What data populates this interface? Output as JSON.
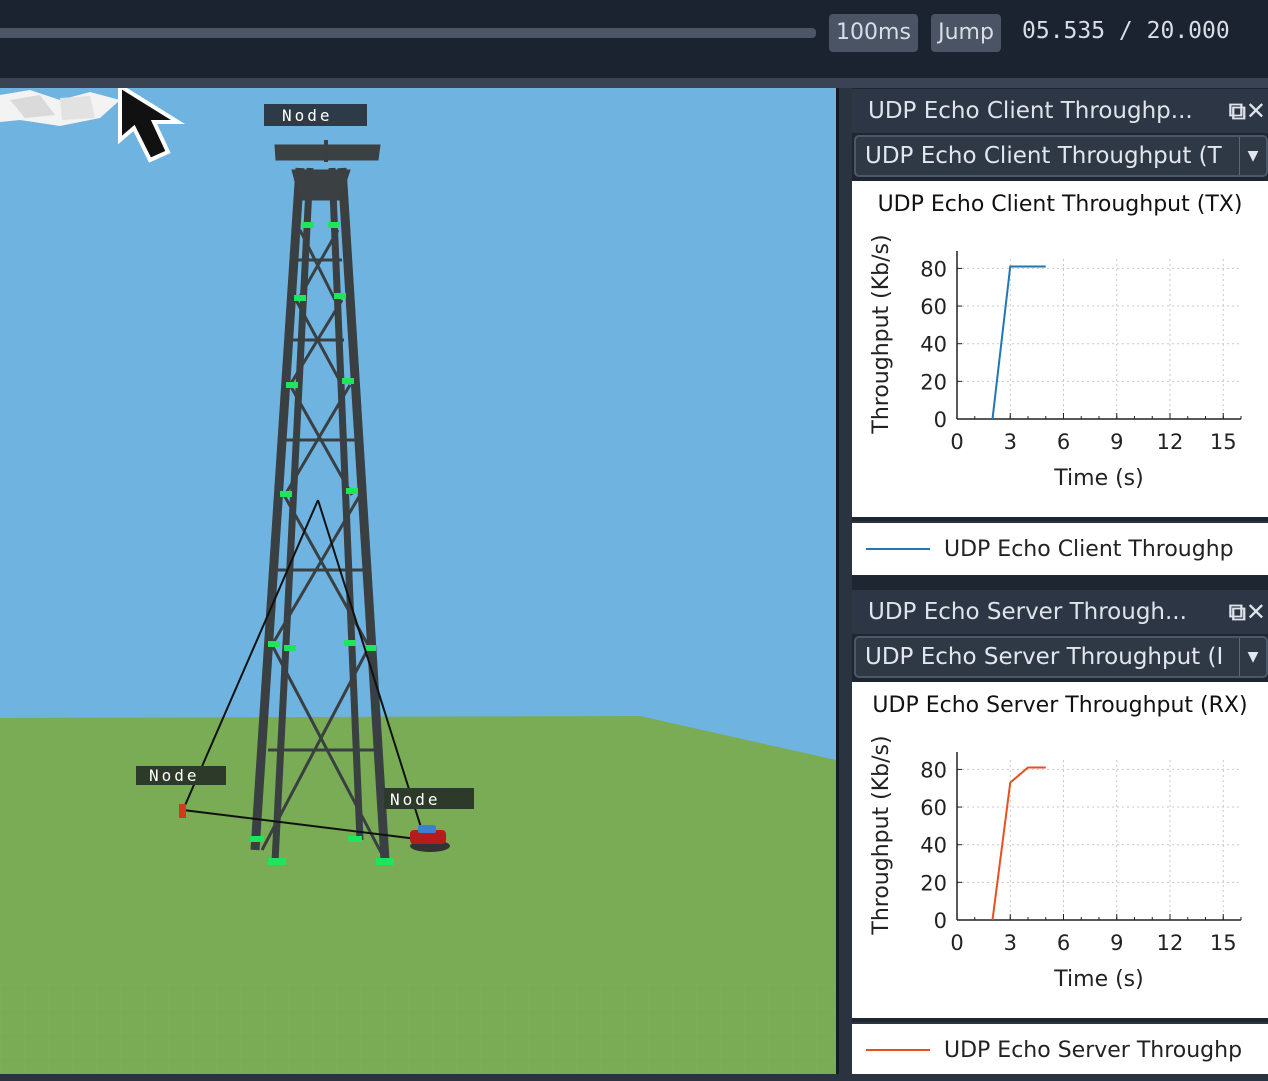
{
  "toolbar": {
    "step_label": "100ms",
    "jump_label": "Jump",
    "time_readout": "05.535 / 20.000"
  },
  "scene": {
    "node_labels": [
      "Node",
      "Node",
      "Node"
    ]
  },
  "panels": [
    {
      "title": "UDP Echo Client Throughp...",
      "combo_value": "UDP Echo Client Throughput (T",
      "chart_title": "UDP Echo Client Throughput (TX)",
      "legend": "UDP Echo Client Throughp",
      "color": "#1f77b4"
    },
    {
      "title": "UDP Echo Server Through...",
      "combo_value": "UDP Echo Server Throughput (I",
      "chart_title": "UDP Echo Server Throughput (RX)",
      "legend": "UDP Echo Server Throughp",
      "color": "#e8501c"
    }
  ],
  "chart_data": [
    {
      "type": "line",
      "title": "UDP Echo Client Throughput (TX)",
      "xlabel": "Time (s)",
      "ylabel": "Throughput (Kb/s)",
      "xlim": [
        0,
        16
      ],
      "ylim": [
        0,
        85
      ],
      "xticks": [
        "0",
        "3",
        "6",
        "9",
        "12",
        "15"
      ],
      "yticks": [
        "0",
        "20",
        "40",
        "60",
        "80"
      ],
      "grid": true,
      "series": [
        {
          "name": "UDP Echo Client Throughp",
          "x": [
            2,
            3,
            5
          ],
          "y": [
            0,
            81,
            81
          ],
          "color": "#1f77b4"
        }
      ]
    },
    {
      "type": "line",
      "title": "UDP Echo Server Throughput (RX)",
      "xlabel": "Time (s)",
      "ylabel": "Throughput (Kb/s)",
      "xlim": [
        0,
        16
      ],
      "ylim": [
        0,
        85
      ],
      "xticks": [
        "0",
        "3",
        "6",
        "9",
        "12",
        "15"
      ],
      "yticks": [
        "0",
        "20",
        "40",
        "60",
        "80"
      ],
      "grid": true,
      "series": [
        {
          "name": "UDP Echo Server Throughp",
          "x": [
            2,
            3,
            4,
            5
          ],
          "y": [
            0,
            73,
            81,
            81
          ],
          "color": "#e8501c"
        }
      ]
    }
  ]
}
